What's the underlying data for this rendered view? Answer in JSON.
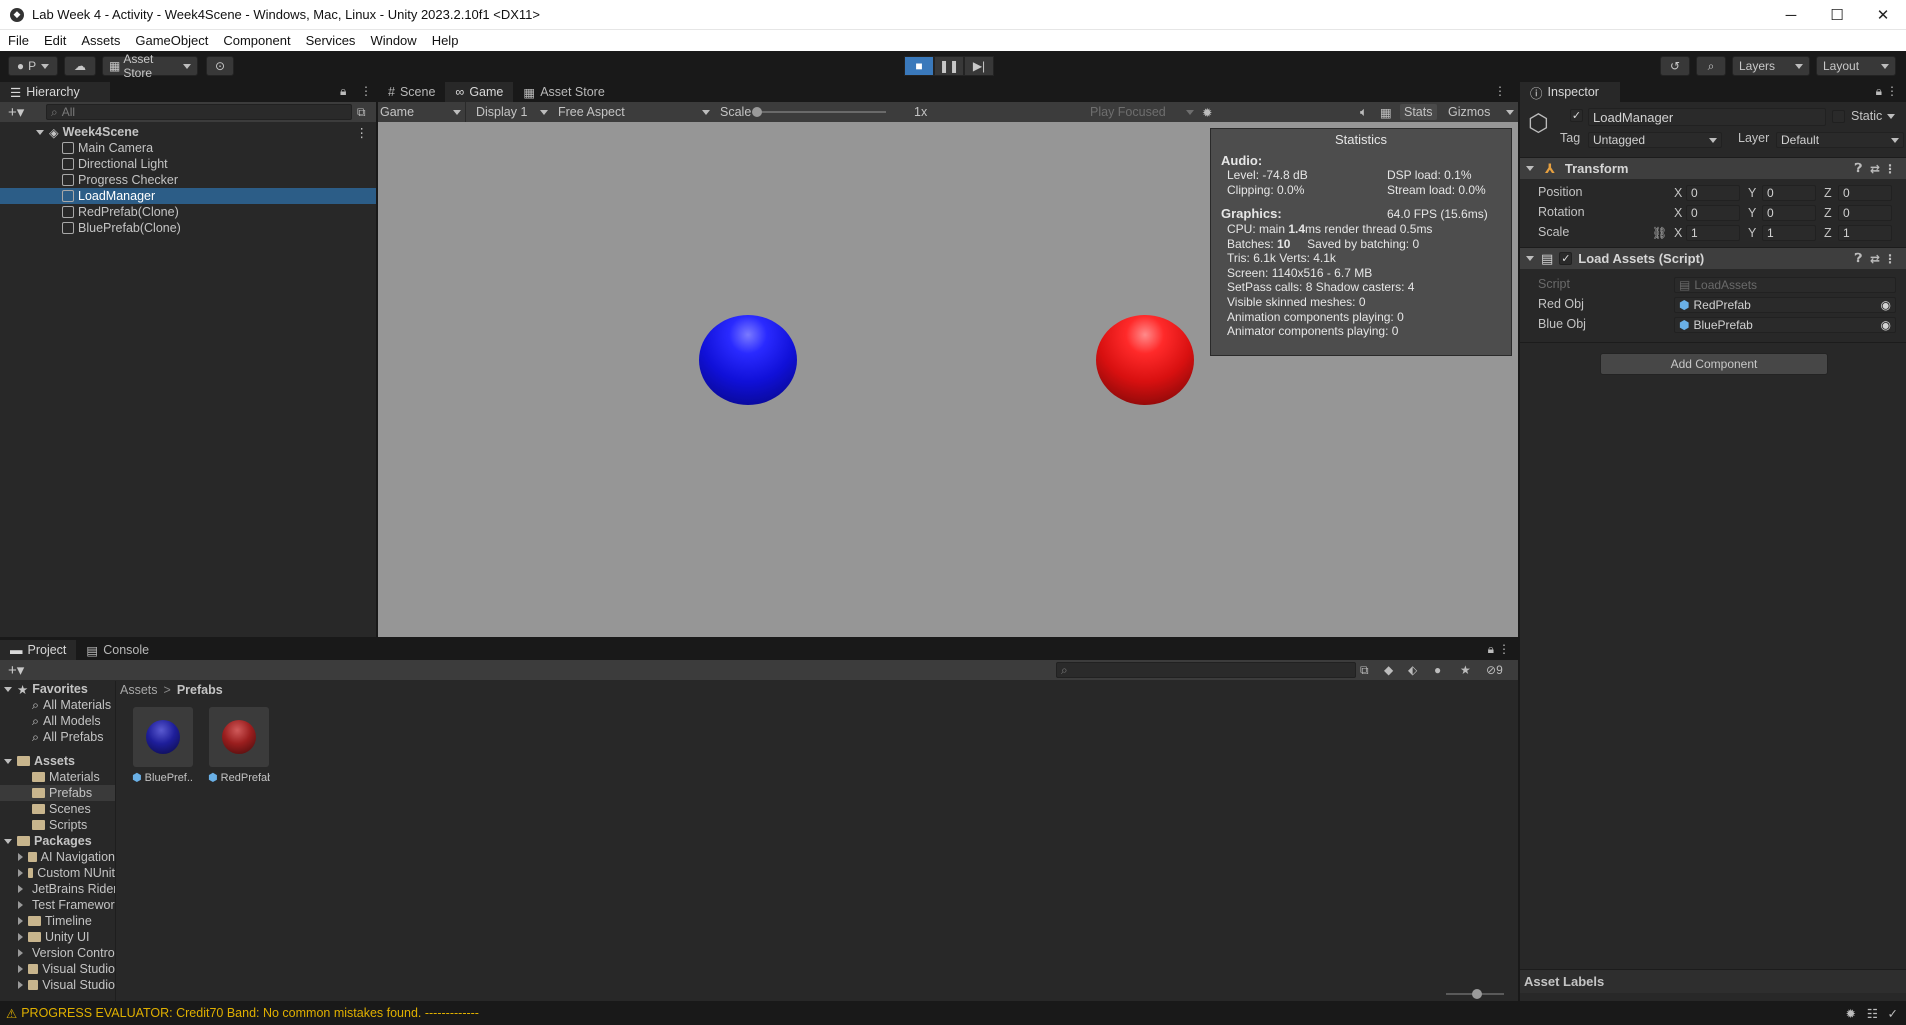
{
  "window": {
    "title": "Lab Week 4 - Activity - Week4Scene - Windows, Mac, Linux - Unity 2023.2.10f1 <DX11>",
    "minimize": "─",
    "maximize": "☐",
    "close": "✕"
  },
  "menu": [
    "File",
    "Edit",
    "Assets",
    "GameObject",
    "Component",
    "Services",
    "Window",
    "Help"
  ],
  "toolbar": {
    "account": "P",
    "asset_store": "Asset Store",
    "layers": "Layers",
    "layout": "Layout"
  },
  "hierarchy": {
    "tab": "Hierarchy",
    "search_placeholder": "All",
    "scene": "Week4Scene",
    "items": [
      {
        "label": "Main Camera",
        "selected": false
      },
      {
        "label": "Directional Light",
        "selected": false
      },
      {
        "label": "Progress Checker",
        "selected": false
      },
      {
        "label": "LoadManager",
        "selected": true
      },
      {
        "label": "RedPrefab(Clone)",
        "selected": false
      },
      {
        "label": "BluePrefab(Clone)",
        "selected": false
      }
    ]
  },
  "game_view": {
    "tabs": [
      "Scene",
      "Game",
      "Asset Store"
    ],
    "mode": "Game",
    "display": "Display 1",
    "aspect": "Free Aspect",
    "scale_label": "Scale",
    "scale_value": "1x",
    "play_focused": "Play Focused",
    "stats_btn": "Stats",
    "gizmos_btn": "Gizmos"
  },
  "statistics": {
    "title": "Statistics",
    "audio_header": "Audio:",
    "level": "Level: -74.8 dB",
    "dsp_load": "DSP load: 0.1%",
    "clipping": "Clipping: 0.0%",
    "stream_load": "Stream load: 0.0%",
    "graphics_header": "Graphics:",
    "fps": "64.0 FPS (15.6ms)",
    "cpu_prefix": "CPU: main ",
    "cpu_main": "1.4",
    "cpu_suffix": "ms  render thread 0.5ms",
    "batches_prefix": "Batches: ",
    "batches": "10",
    "saved_batching": "Saved by batching: 0",
    "tris": "Tris: 6.1k   Verts: 4.1k",
    "screen": "Screen: 1140x516 - 6.7 MB",
    "setpass": "SetPass calls: 8 Shadow casters: 4",
    "skinned": "Visible skinned meshes: 0",
    "animation": "Animation components playing: 0",
    "animator": "Animator components playing: 0"
  },
  "inspector": {
    "tab": "Inspector",
    "object_name": "LoadManager",
    "static_label": "Static",
    "tag_label": "Tag",
    "tag_value": "Untagged",
    "layer_label": "Layer",
    "layer_value": "Default",
    "transform": {
      "title": "Transform",
      "position": {
        "label": "Position",
        "x": "0",
        "y": "0",
        "z": "0"
      },
      "rotation": {
        "label": "Rotation",
        "x": "0",
        "y": "0",
        "z": "0"
      },
      "scale": {
        "label": "Scale",
        "x": "1",
        "y": "1",
        "z": "1"
      }
    },
    "script_component": {
      "title": "Load Assets (Script)",
      "script_label": "Script",
      "script_value": "LoadAssets",
      "red_label": "Red Obj",
      "red_value": "RedPrefab",
      "blue_label": "Blue Obj",
      "blue_value": "BluePrefab"
    },
    "add_component": "Add Component",
    "asset_labels": "Asset Labels"
  },
  "project": {
    "tabs": [
      "Project",
      "Console"
    ],
    "hidden_count": "9",
    "breadcrumb_root": "Assets",
    "breadcrumb_sep": ">",
    "breadcrumb_current": "Prefabs",
    "tree": {
      "favorites": "Favorites",
      "favorite_items": [
        "All Materials",
        "All Models",
        "All Prefabs"
      ],
      "assets": "Assets",
      "asset_folders": [
        "Materials",
        "Prefabs",
        "Scenes",
        "Scripts"
      ],
      "packages": "Packages",
      "package_folders": [
        "AI Navigation",
        "Custom NUnit",
        "JetBrains Rider",
        "Test Framework",
        "Timeline",
        "Unity UI",
        "Version Control",
        "Visual Studio",
        "Visual Studio"
      ]
    },
    "assets": [
      {
        "name": "BluePref...",
        "color": "#1b1b8c"
      },
      {
        "name": "RedPrefab",
        "color": "#8c1b1b"
      }
    ]
  },
  "status": {
    "message": "PROGRESS EVALUATOR: Credit70 Band: No common mistakes found. -------------"
  },
  "colors": {
    "selection": "#2c5d87",
    "play_active": "#3a79bb",
    "viewport_bg": "#969696",
    "blue_sphere": "#1a1aee",
    "red_sphere": "#ee1a1a",
    "warning": "#e0b000"
  }
}
